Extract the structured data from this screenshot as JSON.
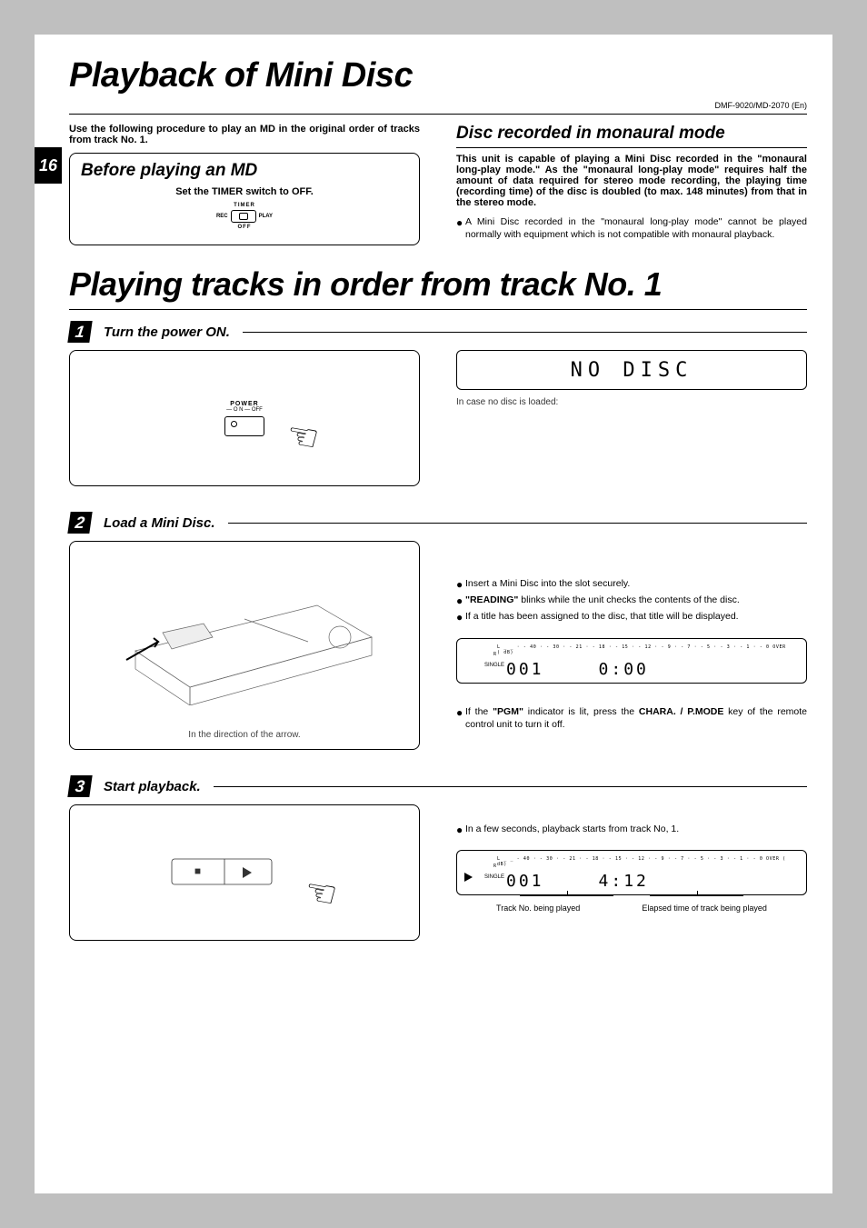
{
  "model_header": "DMF-9020/MD-2070 (En)",
  "page_number": "16",
  "h1": "Playback of Mini Disc",
  "intro": "Use the following procedure to play an MD in the original order of tracks from track No. 1.",
  "before_box": {
    "title": "Before playing an MD",
    "instruction": "Set the TIMER switch to OFF.",
    "labels": {
      "top": "TIMER",
      "left": "REC",
      "right": "PLAY",
      "bottom": "OFF"
    }
  },
  "mono": {
    "title": "Disc recorded in monaural mode",
    "body": "This unit is capable of playing a Mini Disc recorded in the \"monaural long-play mode.\" As the \"monaural long-play mode\" requires half the amount of data required for stereo mode recording, the playing time (recording time) of the disc is doubled (to max. 148 minutes) from that in the stereo mode.",
    "note": "A Mini Disc recorded in the \"monaural long-play mode\" cannot be played normally with equipment which is not compatible with monaural playback."
  },
  "h2": "Playing tracks in order from track No. 1",
  "step1": {
    "num": "1",
    "title": "Turn the power ON.",
    "pwr_label": "POWER",
    "pwr_sub": "— O N   — OFF",
    "display": "NO DISC",
    "caption": "In case no disc is loaded:"
  },
  "step2": {
    "num": "2",
    "title": "Load a Mini Disc.",
    "illus_caption": "In the direction of the arrow.",
    "notes": [
      "Insert a Mini Disc into the slot securely.",
      "\"READING\" blinks while the unit checks the contents of the disc.",
      "If a title has been assigned to the disc, that title will be displayed."
    ],
    "scale": "L _ _ · - 40 · - 30 · - 21 · - 18 · - 15 · - 12 · - 9 · - 7 · - 5 · - 3 · - 1 · - 0  OVER ( dB)",
    "single": "SINGLE",
    "trk": "001",
    "time": "0:00",
    "pgm_note_before": "If the ",
    "pgm_bold1": "\"PGM\"",
    "pgm_mid": " indicator is lit, press the ",
    "pgm_bold2": "CHARA. / P.MODE",
    "pgm_after": " key of the remote control unit to turn it off."
  },
  "step3": {
    "num": "3",
    "title": "Start playback.",
    "note": "In a few seconds, playback starts from track No, 1.",
    "scale": "L _ _ - 40 · - 30 · - 21 · - 18 · - 15 · - 12 · - 9 · - 7 · - 5 · - 3 · - 1 · - 0  OVER ( dB)",
    "single": "SINGLE",
    "trk": "001",
    "time": "4:12",
    "annot1": "Track No. being played",
    "annot2": "Elapsed time of track being played"
  }
}
